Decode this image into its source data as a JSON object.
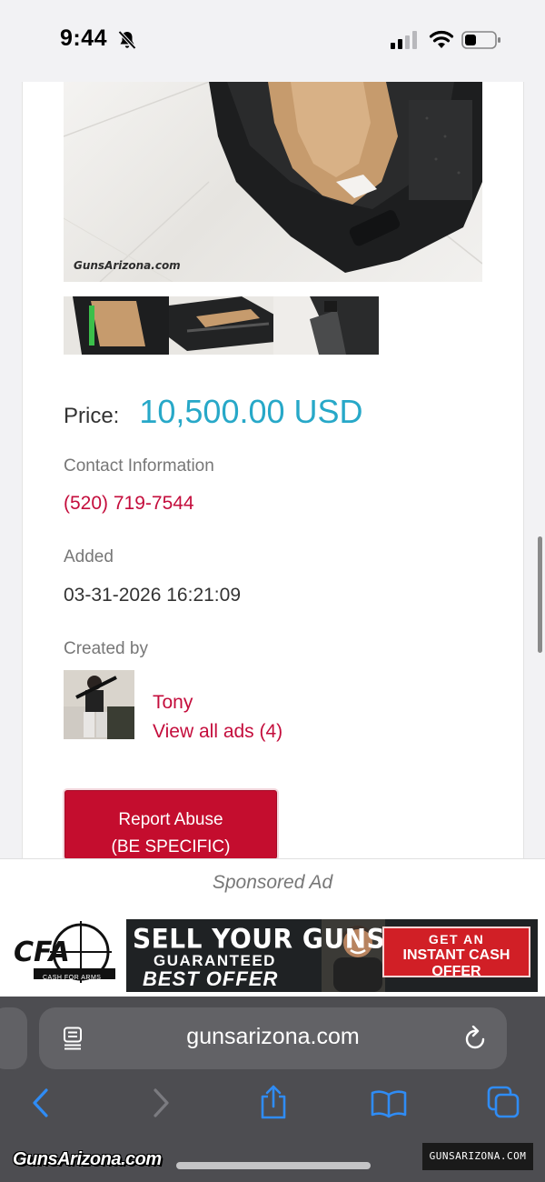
{
  "status_bar": {
    "time": "9:44"
  },
  "listing": {
    "photo_watermark": "GunsArizona.com",
    "price_label": "Price:",
    "price_value": "10,500.00 USD",
    "contact_label": "Contact Information",
    "phone": "(520) 719-7544",
    "added_label": "Added",
    "added_value": "03-31-2026 16:21:09",
    "created_by_label": "Created by",
    "creator_name": "Tony",
    "view_all_ads": "View all ads (4)",
    "report_line1": "Report Abuse",
    "report_line2": "(BE SPECIFIC)"
  },
  "sponsored": {
    "label": "Sponsored Ad",
    "ad_logo_text": "CASH FOR ARMS",
    "ad_line1": "SELL YOUR GUNS",
    "ad_line2": "GUARANTEED",
    "ad_line3": "BEST OFFER",
    "ad_cta_line1": "GET AN",
    "ad_cta_line2": "INSTANT CASH OFFER"
  },
  "browser": {
    "url": "gunsarizona.com"
  },
  "watermarks": {
    "left": "GunsArizona.com",
    "right": "GUNSARIZONA.COM"
  },
  "colors": {
    "accent_red": "#c40d3c",
    "price_blue": "#27a8c8",
    "browser_bar": "#4d4d51",
    "ios_blue": "#2f8cf5"
  }
}
